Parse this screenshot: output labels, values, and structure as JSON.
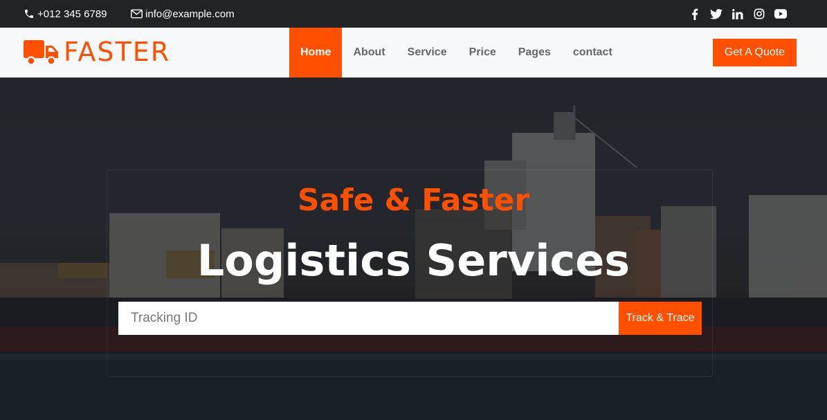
{
  "topbar": {
    "phone": "+012 345 6789",
    "email": "info@example.com",
    "socials": [
      "facebook-icon",
      "twitter-icon",
      "linkedin-icon",
      "instagram-icon",
      "youtube-icon"
    ]
  },
  "brand": {
    "name": "FASTER",
    "icon": "truck-icon"
  },
  "nav": {
    "items": [
      "Home",
      "About",
      "Service",
      "Price",
      "Pages",
      "contact"
    ],
    "active": "Home"
  },
  "quote_button": "Get A Quote",
  "hero": {
    "subtitle": "Safe & Faster",
    "title": "Logistics Services",
    "tracking": {
      "placeholder": "Tracking ID",
      "value": "",
      "button": "Track & Trace"
    }
  },
  "colors": {
    "accent": "#ff4f00",
    "topbar": "#212327",
    "navbar": "#f7f8fa"
  }
}
